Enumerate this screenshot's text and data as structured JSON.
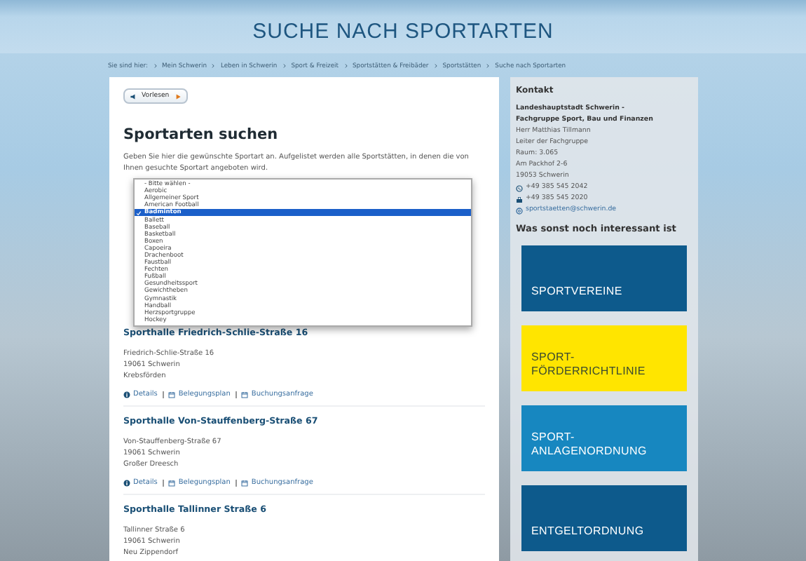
{
  "page_title": "SUCHE NACH SPORTARTEN",
  "breadcrumb": [
    "Sie sind hier:",
    "Mein Schwerin",
    "Leben in Schwerin",
    "Sport & Freizeit",
    "Sportstätten & Freibäder",
    "Sportstätten",
    "Suche nach Sportarten"
  ],
  "read_aloud_button": {
    "label": "Vorlesen"
  },
  "heading": "Sportarten suchen",
  "intro": "Geben Sie hier die gewünschte Sportart an. Aufgelistet werden alle Sportstätten, in denen die von Ihnen gesuchte Sportart angeboten wird.",
  "sport_dropdown": {
    "options": [
      {
        "label": "- Bitte wählen -",
        "selected": false
      },
      {
        "label": "Aerobic",
        "selected": false
      },
      {
        "label": "Allgemeiner Sport",
        "selected": false
      },
      {
        "label": "American Football",
        "selected": false
      },
      {
        "label": "Badminton",
        "selected": true
      },
      {
        "label": "Ballett",
        "selected": false
      },
      {
        "label": "Baseball",
        "selected": false
      },
      {
        "label": "Basketball",
        "selected": false
      },
      {
        "label": "Boxen",
        "selected": false
      },
      {
        "label": "Capoeira",
        "selected": false
      },
      {
        "label": "Drachenboot",
        "selected": false
      },
      {
        "label": "Faustball",
        "selected": false
      },
      {
        "label": "Fechten",
        "selected": false
      },
      {
        "label": "Fußball",
        "selected": false
      },
      {
        "label": "Gesundheitssport",
        "selected": false
      },
      {
        "label": "Gewichtheben",
        "selected": false
      },
      {
        "label": "Gymnastik",
        "selected": false
      },
      {
        "label": "Handball",
        "selected": false
      },
      {
        "label": "Herzsportgruppe",
        "selected": false
      },
      {
        "label": "Hockey",
        "selected": false
      }
    ]
  },
  "results": [
    {
      "title": "Sporthalle Friedrich-Schlie-Straße 16",
      "address": [
        "Friedrich-Schlie-Straße 16",
        "19061 Schwerin",
        "Krebsförden"
      ],
      "links": [
        "Details",
        "Belegungsplan",
        "Buchungsanfrage"
      ]
    },
    {
      "title": "Sporthalle Von-Stauffenberg-Straße 67",
      "address": [
        "Von-Stauffenberg-Straße 67",
        "19061 Schwerin",
        "Großer Dreesch"
      ],
      "links": [
        "Details",
        "Belegungsplan",
        "Buchungsanfrage"
      ]
    },
    {
      "title": "Sporthalle Tallinner Straße 6",
      "address": [
        "Tallinner Straße 6",
        "19061 Schwerin",
        "Neu Zippendorf"
      ]
    }
  ],
  "contact": {
    "heading": "Kontakt",
    "organization": [
      "Landeshauptstadt Schwerin -",
      "Fachgruppe Sport, Bau und Finanzen"
    ],
    "lines": [
      "Herr Matthias Tillmann",
      "Leiter der Fachgruppe",
      "Raum: 3.065",
      "Am Packhof 2-6",
      "19053 Schwerin"
    ],
    "phone": "+49 385 545 2042",
    "fax": "+49 385 545 2020",
    "email": "sportstaetten@schwerin.de"
  },
  "more_heading": "Was sonst noch interessant ist",
  "tiles": [
    {
      "label": "SPORTVEREINE",
      "color": "#0d5a8c"
    },
    {
      "label": "SPORT-\nFÖRDERRICHTLINIE",
      "color": "#ffe500"
    },
    {
      "label": "SPORT-\nANLAGENORDNUNG",
      "color": "#1787c0"
    },
    {
      "label": "ENTGELTORDNUNG",
      "color": "#0d5a8c"
    }
  ]
}
